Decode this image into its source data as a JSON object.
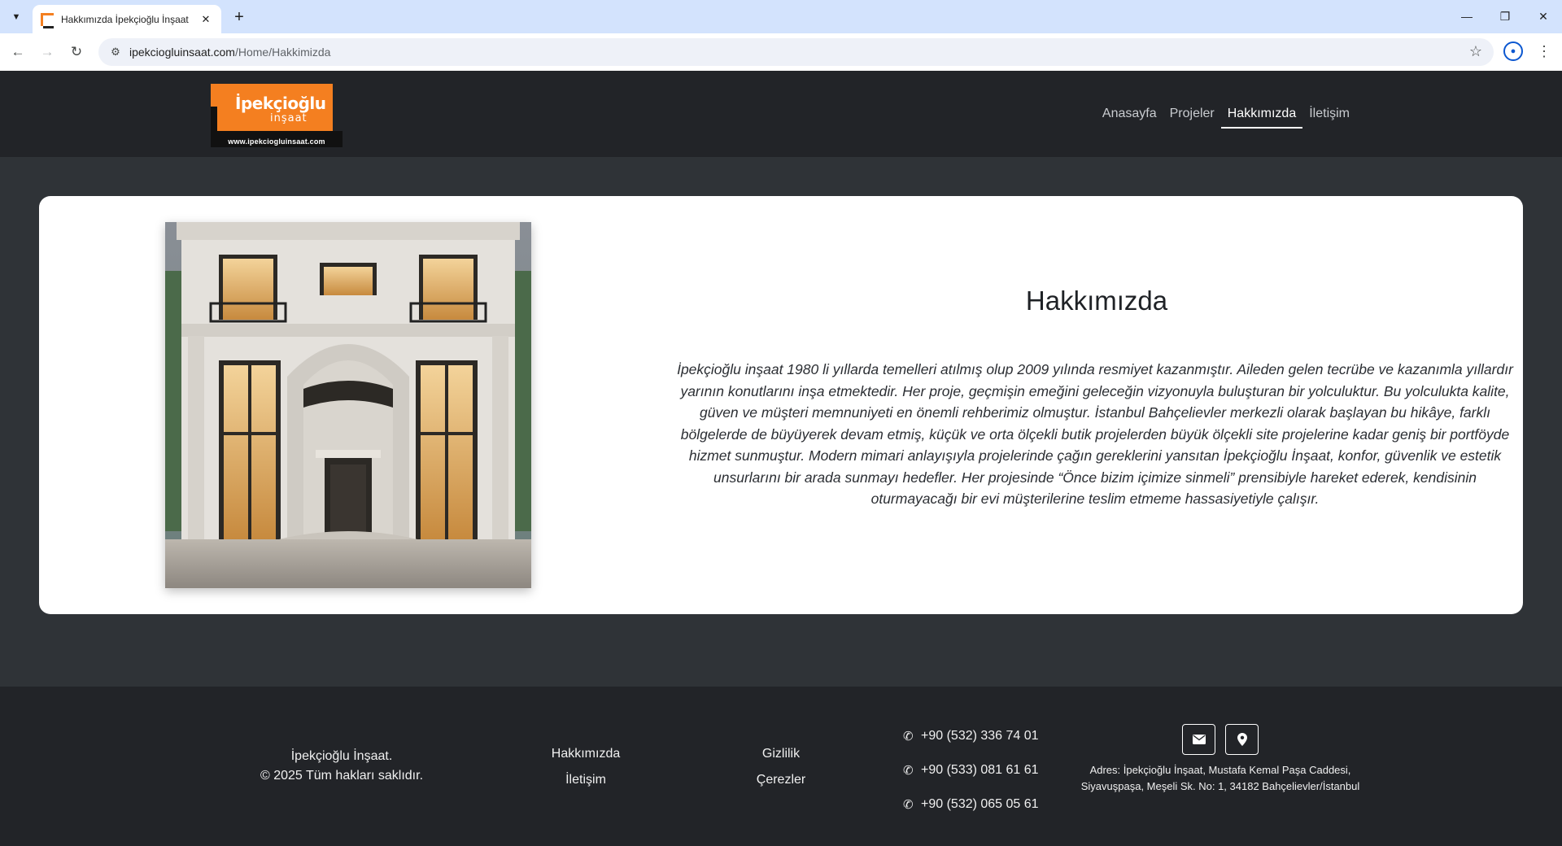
{
  "browser": {
    "tab_title": "Hakkımızda İpekçioğlu İnşaat",
    "url_host": "ipekciogluinsaat.com",
    "url_path": "/Home/Hakkimizda"
  },
  "logo": {
    "name": "İpekçioğlu",
    "sub": "inşaat",
    "url": "www.ipekciogluinsaat.com"
  },
  "nav": {
    "items": [
      "Anasayfa",
      "Projeler",
      "Hakkımızda",
      "İletişim"
    ],
    "active": "Hakkımızda"
  },
  "about": {
    "title": "Hakkımızda",
    "text": "İpekçioğlu inşaat 1980 li yıllarda temelleri atılmış olup 2009 yılında resmiyet kazanmıştır. Aileden gelen tecrübe ve kazanımla yıllardır yarının konutlarını inşa etmektedir. Her proje, geçmişin emeğini geleceğin vizyonuyla buluşturan bir yolculuktur. Bu yolculukta kalite, güven ve müşteri memnuniyeti en önemli rehberimiz olmuştur. İstanbul Bahçelievler merkezli olarak başlayan bu hikâye, farklı bölgelerde de büyüyerek devam etmiş, küçük ve orta ölçekli butik projelerden büyük ölçekli site projelerine kadar geniş bir portföyde hizmet sunmuştur. Modern mimari anlayışıyla projelerinde çağın gereklerini yansıtan İpekçioğlu İnşaat, konfor, güvenlik ve estetik unsurlarını bir arada sunmayı hedefler. Her projesinde “Önce bizim içimize sinmeli” prensibiyle hareket ederek, kendisinin oturmayacağı bir evi müşterilerine teslim etmeme hassasiyetiyle çalışır."
  },
  "footer": {
    "brand_line1": "İpekçioğlu İnşaat.",
    "brand_line2": "© 2025 Tüm hakları saklıdır.",
    "col1": [
      "Hakkımızda",
      "İletişim"
    ],
    "col2": [
      "Gizlilik",
      "Çerezler"
    ],
    "phones": [
      "+90 (532) 336 74 01",
      "+90 (533) 081 61 61",
      "+90 (532) 065 05 61"
    ],
    "address_line1": "Adres: İpekçioğlu İnşaat, Mustafa Kemal Paşa Caddesi,",
    "address_line2": "Siyavuşpaşa, Meşeli Sk. No: 1, 34182 Bahçelievler/İstanbul"
  },
  "icons": {
    "phone": "phone-icon",
    "email": "envelope-icon",
    "location": "map-pin-icon"
  }
}
